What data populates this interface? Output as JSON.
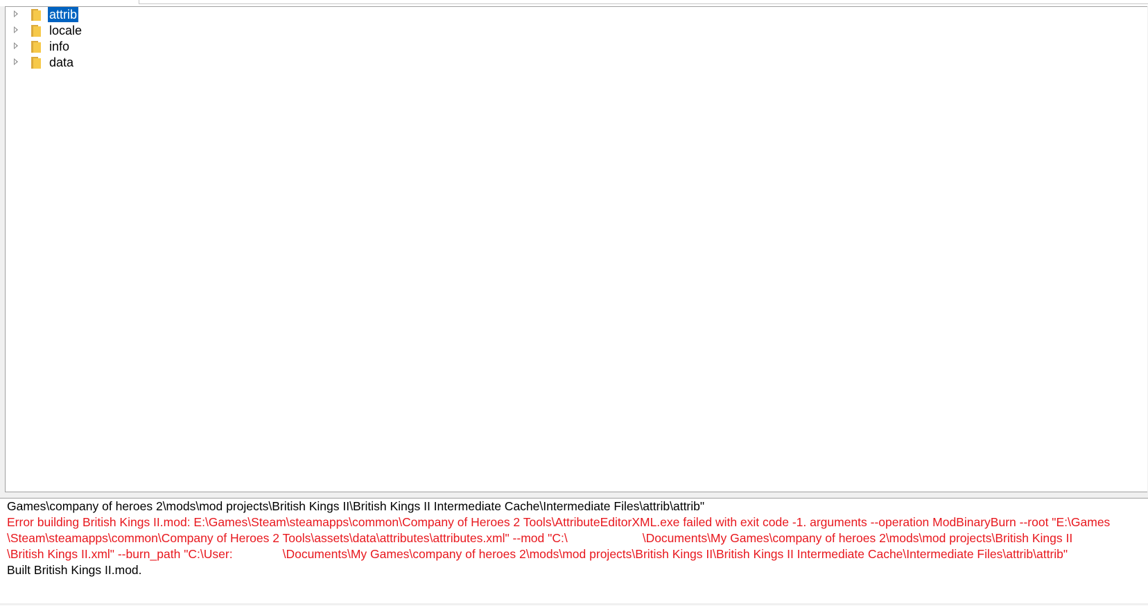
{
  "tree": {
    "items": [
      {
        "label": "attrib",
        "selected": true,
        "icon": "folder-icon"
      },
      {
        "label": "locale",
        "selected": false,
        "icon": "folder-icon"
      },
      {
        "label": "info",
        "selected": false,
        "icon": "folder-icon"
      },
      {
        "label": "data",
        "selected": false,
        "icon": "folder-icon"
      }
    ],
    "selection_color": "#0063c1"
  },
  "output": {
    "lines": [
      {
        "type": "normal",
        "text": "Games\\company of heroes 2\\mods\\mod projects\\British Kings II\\British Kings II Intermediate Cache\\Intermediate Files\\attrib\\attrib\""
      },
      {
        "type": "error",
        "text": "Error building British Kings II.mod: E:\\Games\\Steam\\steamapps\\common\\Company of Heroes 2 Tools\\AttributeEditorXML.exe failed with exit code -1. arguments --operation ModBinaryBurn --root \"E:\\Games"
      },
      {
        "type": "error",
        "text_before": "\\Steam\\steamapps\\common\\Company of Heroes 2 Tools\\assets\\data\\attributes\\attributes.xml\" --mod \"C:\\",
        "text_after": "\\Documents\\My Games\\company of heroes 2\\mods\\mod projects\\British Kings II"
      },
      {
        "type": "error",
        "text_before": "\\British Kings II.xml\" --burn_path \"C:\\User:",
        "text_after": "\\Documents\\My Games\\company of heroes 2\\mods\\mod projects\\British Kings II\\British Kings II Intermediate Cache\\Intermediate Files\\attrib\\attrib\""
      },
      {
        "type": "normal",
        "text": "Built British Kings II.mod."
      }
    ],
    "error_color": "#e8181e"
  }
}
